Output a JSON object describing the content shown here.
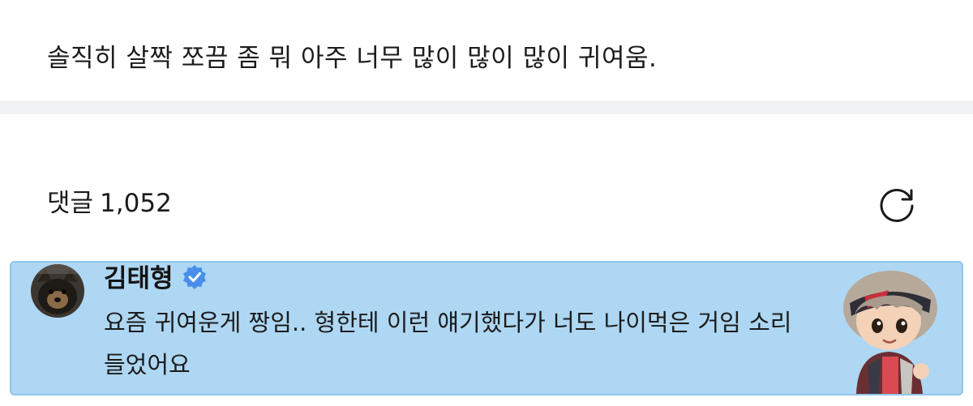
{
  "post": {
    "text": "솔직히 살짝 쪼끔 좀 뭐 아주 너무 많이 많이 많이 귀여움."
  },
  "comments": {
    "label": "댓글",
    "count": "1,052",
    "refresh_icon": "refresh-icon"
  },
  "highlighted_comment": {
    "author": "김태형",
    "verified_icon": "verified-badge-icon",
    "text": "요즘 귀여운게 짱임.. 형한테 이런 얘기했다가 너도 나이먹은 거임 소리 들었어요",
    "accent_background": "#aed7f3",
    "verified_color": "#4a8fe7"
  }
}
